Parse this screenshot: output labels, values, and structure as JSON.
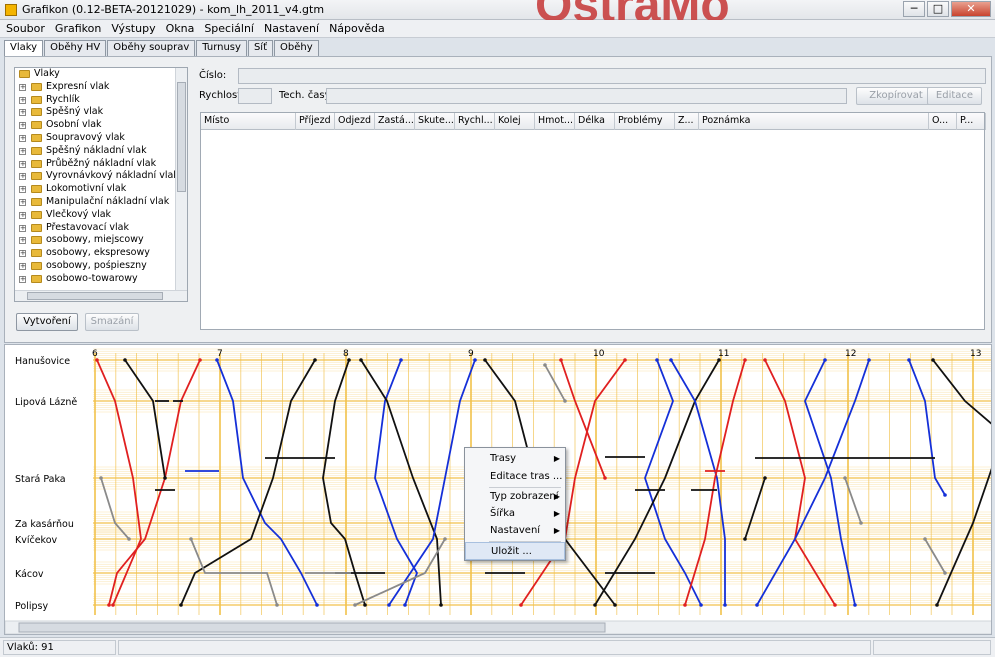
{
  "window": {
    "title": "Grafikon (0.12-BETA-20121029) - kom_lh_2011_v4.gtm",
    "watermark": "OstraMo",
    "btn_min": "─",
    "btn_max": "□",
    "btn_close": "✕"
  },
  "menu": [
    "Soubor",
    "Grafikon",
    "Výstupy",
    "Okna",
    "Speciální",
    "Nastavení",
    "Nápověda"
  ],
  "tabs": [
    "Vlaky",
    "Oběhy HV",
    "Oběhy souprav",
    "Turnusy",
    "Síť",
    "Oběhy"
  ],
  "tree": {
    "root": "Vlaky",
    "items": [
      "Expresní vlak",
      "Rychlík",
      "Spěšný vlak",
      "Osobní vlak",
      "Soupravový vlak",
      "Spěšný nákladní vlak",
      "Průběžný nákladní vlak",
      "Vyrovnávkový nákladní vlak",
      "Lokomotivní vlak",
      "Manipulační nákladní vlak",
      "Vlečkový vlak",
      "Přestavovací vlak",
      "osobowy, miejscowy",
      "osobowy, ekspresowy",
      "osobowy, pośpieszny",
      "osobowo-towarowy"
    ]
  },
  "buttons": {
    "create": "Vytvoření",
    "delete": "Smazání",
    "copy": "Zkopírovat",
    "edit": "Editace"
  },
  "form": {
    "number_label": "Číslo:",
    "speed_label": "Rychlost:",
    "tech_label": "Tech. časy:"
  },
  "table_headers": [
    "Místo",
    "Příjezd",
    "Odjezd",
    "Zastá...",
    "Skute...",
    "Rychl...",
    "Kolej",
    "Hmot...",
    "Délka",
    "Problémy",
    "Z...",
    "Poznámka",
    "O...",
    "P..."
  ],
  "graph": {
    "stations": [
      "Hanušovice",
      "Lipová Lázně",
      "Stará Paka",
      "Za kasárňou",
      "Kvíčekov",
      "Kácov",
      "Polipsy"
    ],
    "hours": [
      "6",
      "7",
      "8",
      "9",
      "10",
      "11",
      "12",
      "13"
    ]
  },
  "context_menu": [
    "Trasy",
    "Editace tras ...",
    "Typ zobrazení",
    "Šířka",
    "Nastavení",
    "Uložit ..."
  ],
  "status": {
    "trains": "Vlaků: 91"
  },
  "colors": {
    "grid": "#f2c14a",
    "red": "#e02020",
    "blue": "#1530d8",
    "black": "#111111",
    "gray": "#8a8a8a"
  }
}
